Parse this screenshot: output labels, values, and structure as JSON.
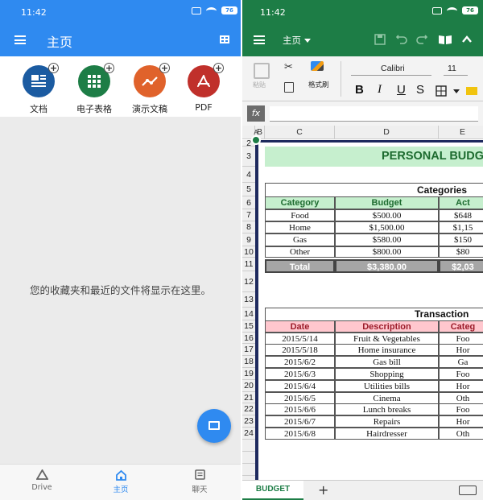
{
  "left": {
    "status": {
      "time": "11:42",
      "battery": "76"
    },
    "app_title": "主页",
    "tiles": [
      {
        "label": "文档",
        "color": "#1b5ba1"
      },
      {
        "label": "电子表格",
        "color": "#1d7d46"
      },
      {
        "label": "演示文稿",
        "color": "#e0622b"
      },
      {
        "label": "PDF",
        "color": "#c0302b"
      }
    ],
    "empty_message": "您的收藏夹和最近的文件将显示在这里。",
    "nav": [
      {
        "label": "Drive"
      },
      {
        "label": "主页"
      },
      {
        "label": "聊天"
      }
    ]
  },
  "right": {
    "status": {
      "time": "11:42",
      "battery": "76"
    },
    "app_title": "主页",
    "ribbon": {
      "paste_label": "粘贴",
      "format_painter_label": "格式刷",
      "font_name": "Calibri",
      "font_size": "11",
      "bold": "B",
      "italic": "I",
      "underline": "U",
      "strike": "S"
    },
    "fx_label": "fx",
    "columns": [
      "A",
      "B",
      "C",
      "D",
      "E"
    ],
    "rows": [
      "2",
      "3",
      "4",
      "5",
      "6",
      "7",
      "8",
      "9",
      "10",
      "11",
      "12",
      "13",
      "14",
      "15",
      "16",
      "17",
      "18",
      "19",
      "20",
      "21",
      "22",
      "23",
      "24"
    ],
    "title": "PERSONAL BUDG",
    "categories_title": "Categories",
    "categories_headers": [
      "Category",
      "Budget",
      "Act"
    ],
    "categories_rows": [
      [
        "Food",
        "$500.00",
        "$648"
      ],
      [
        "Home",
        "$1,500.00",
        "$1,15"
      ],
      [
        "Gas",
        "$580.00",
        "$150"
      ],
      [
        "Other",
        "$800.00",
        "$80"
      ]
    ],
    "total_row": [
      "Total",
      "$3,380.00",
      "$2,03"
    ],
    "transaction_title": "Transaction",
    "transaction_headers": [
      "Date",
      "Description",
      "Categ"
    ],
    "transaction_rows": [
      [
        "2015/5/14",
        "Fruit & Vegetables",
        "Foo"
      ],
      [
        "2015/5/18",
        "Home insurance",
        "Hor"
      ],
      [
        "2015/6/2",
        "Gas bill",
        "Ga"
      ],
      [
        "2015/6/3",
        "Shopping",
        "Foo"
      ],
      [
        "2015/6/4",
        "Utilities bills",
        "Hor"
      ],
      [
        "2015/6/5",
        "Cinema",
        "Oth"
      ],
      [
        "2015/6/6",
        "Lunch breaks",
        "Foo"
      ],
      [
        "2015/6/7",
        "Repairs",
        "Hor"
      ],
      [
        "2015/6/8",
        "Hairdresser",
        "Oth"
      ]
    ],
    "sheet_tab": "BUDGET",
    "add_sheet": "+"
  }
}
